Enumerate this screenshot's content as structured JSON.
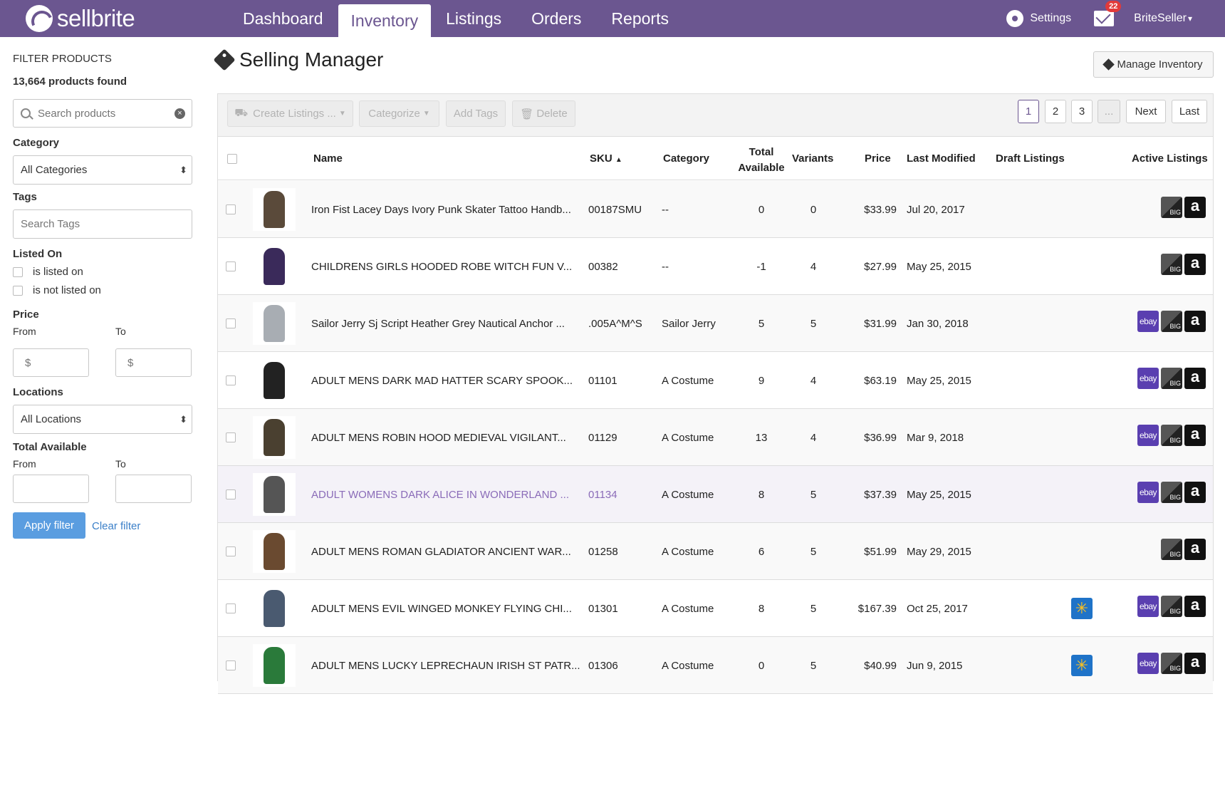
{
  "app": {
    "logo_text": "sellbrite",
    "nav": [
      {
        "label": "Dashboard",
        "active": false
      },
      {
        "label": "Inventory",
        "active": true
      },
      {
        "label": "Listings",
        "active": false
      },
      {
        "label": "Orders",
        "active": false
      },
      {
        "label": "Reports",
        "active": false
      }
    ],
    "settings_label": "Settings",
    "mail_count": "22",
    "user_label": "BriteSeller"
  },
  "filters": {
    "title": "FILTER PRODUCTS",
    "found": "13,664 products found",
    "search_placeholder": "Search products",
    "category_label": "Category",
    "category_value": "All Categories",
    "tags_label": "Tags",
    "tags_placeholder": "Search Tags",
    "listed_on_label": "Listed On",
    "listed_on_options": [
      "is listed on",
      "is not listed on"
    ],
    "price_label": "Price",
    "from_label": "From",
    "to_label": "To",
    "price_placeholder": "$",
    "locations_label": "Locations",
    "locations_value": "All Locations",
    "total_available_label": "Total Available",
    "apply_label": "Apply filter",
    "clear_label": "Clear filter"
  },
  "main": {
    "title": "Selling Manager",
    "manage_inventory_label": "Manage Inventory",
    "toolbar": {
      "create_listings": "Create Listings ...",
      "categorize": "Categorize",
      "add_tags": "Add Tags",
      "delete": "Delete"
    },
    "pagination": [
      "1",
      "2",
      "3",
      "...",
      "Next",
      "Last"
    ],
    "columns": {
      "name": "Name",
      "sku": "SKU",
      "category": "Category",
      "total_available": "Total Available",
      "variants": "Variants",
      "price": "Price",
      "last_modified": "Last Modified",
      "draft_listings": "Draft Listings",
      "active_listings": "Active Listings"
    },
    "rows": [
      {
        "name": "Iron Fist Lacey Days Ivory Punk Skater Tattoo Handb...",
        "sku": "00187SMU",
        "category": "--",
        "total": "0",
        "variants": "0",
        "price": "$33.99",
        "modified": "Jul 20, 2017",
        "walmart": false,
        "ebay": false,
        "thumb_color": "#5a4a3a"
      },
      {
        "name": "CHILDRENS GIRLS HOODED ROBE WITCH FUN V...",
        "sku": "00382",
        "category": "--",
        "total": "-1",
        "variants": "4",
        "price": "$27.99",
        "modified": "May 25, 2015",
        "walmart": false,
        "ebay": false,
        "thumb_color": "#3a2a5a"
      },
      {
        "name": "Sailor Jerry Sj Script Heather Grey Nautical Anchor ...",
        "sku": ".005A^M^S",
        "category": "Sailor Jerry",
        "total": "5",
        "variants": "5",
        "price": "$31.99",
        "modified": "Jan 30, 2018",
        "walmart": false,
        "ebay": true,
        "thumb_color": "#a8adb3"
      },
      {
        "name": "ADULT MENS DARK MAD HATTER SCARY SPOOK...",
        "sku": "01101",
        "category": "A Costume",
        "total": "9",
        "variants": "4",
        "price": "$63.19",
        "modified": "May 25, 2015",
        "walmart": false,
        "ebay": true,
        "thumb_color": "#222222"
      },
      {
        "name": "ADULT MENS ROBIN HOOD MEDIEVAL VIGILANT...",
        "sku": "01129",
        "category": "A Costume",
        "total": "13",
        "variants": "4",
        "price": "$36.99",
        "modified": "Mar 9, 2018",
        "walmart": false,
        "ebay": true,
        "thumb_color": "#4a4030"
      },
      {
        "name": "ADULT WOMENS DARK ALICE IN WONDERLAND ...",
        "sku": "01134",
        "category": "A Costume",
        "total": "8",
        "variants": "5",
        "price": "$37.39",
        "modified": "May 25, 2015",
        "walmart": false,
        "ebay": true,
        "thumb_color": "#555555"
      },
      {
        "name": "ADULT MENS ROMAN GLADIATOR ANCIENT WAR...",
        "sku": "01258",
        "category": "A Costume",
        "total": "6",
        "variants": "5",
        "price": "$51.99",
        "modified": "May 29, 2015",
        "walmart": false,
        "ebay": false,
        "thumb_color": "#6a4a30"
      },
      {
        "name": "ADULT MENS EVIL WINGED MONKEY FLYING CHI...",
        "sku": "01301",
        "category": "A Costume",
        "total": "8",
        "variants": "5",
        "price": "$167.39",
        "modified": "Oct 25, 2017",
        "walmart": true,
        "ebay": true,
        "thumb_color": "#4a5a70"
      },
      {
        "name": "ADULT MENS LUCKY LEPRECHAUN IRISH ST PATR...",
        "sku": "01306",
        "category": "A Costume",
        "total": "0",
        "variants": "5",
        "price": "$40.99",
        "modified": "Jun 9, 2015",
        "walmart": true,
        "ebay": true,
        "thumb_color": "#2a7a3a"
      }
    ],
    "badge_text": {
      "ebay": "ebay",
      "big": "BIG",
      "amazon": "a",
      "walmart": "✳"
    }
  }
}
